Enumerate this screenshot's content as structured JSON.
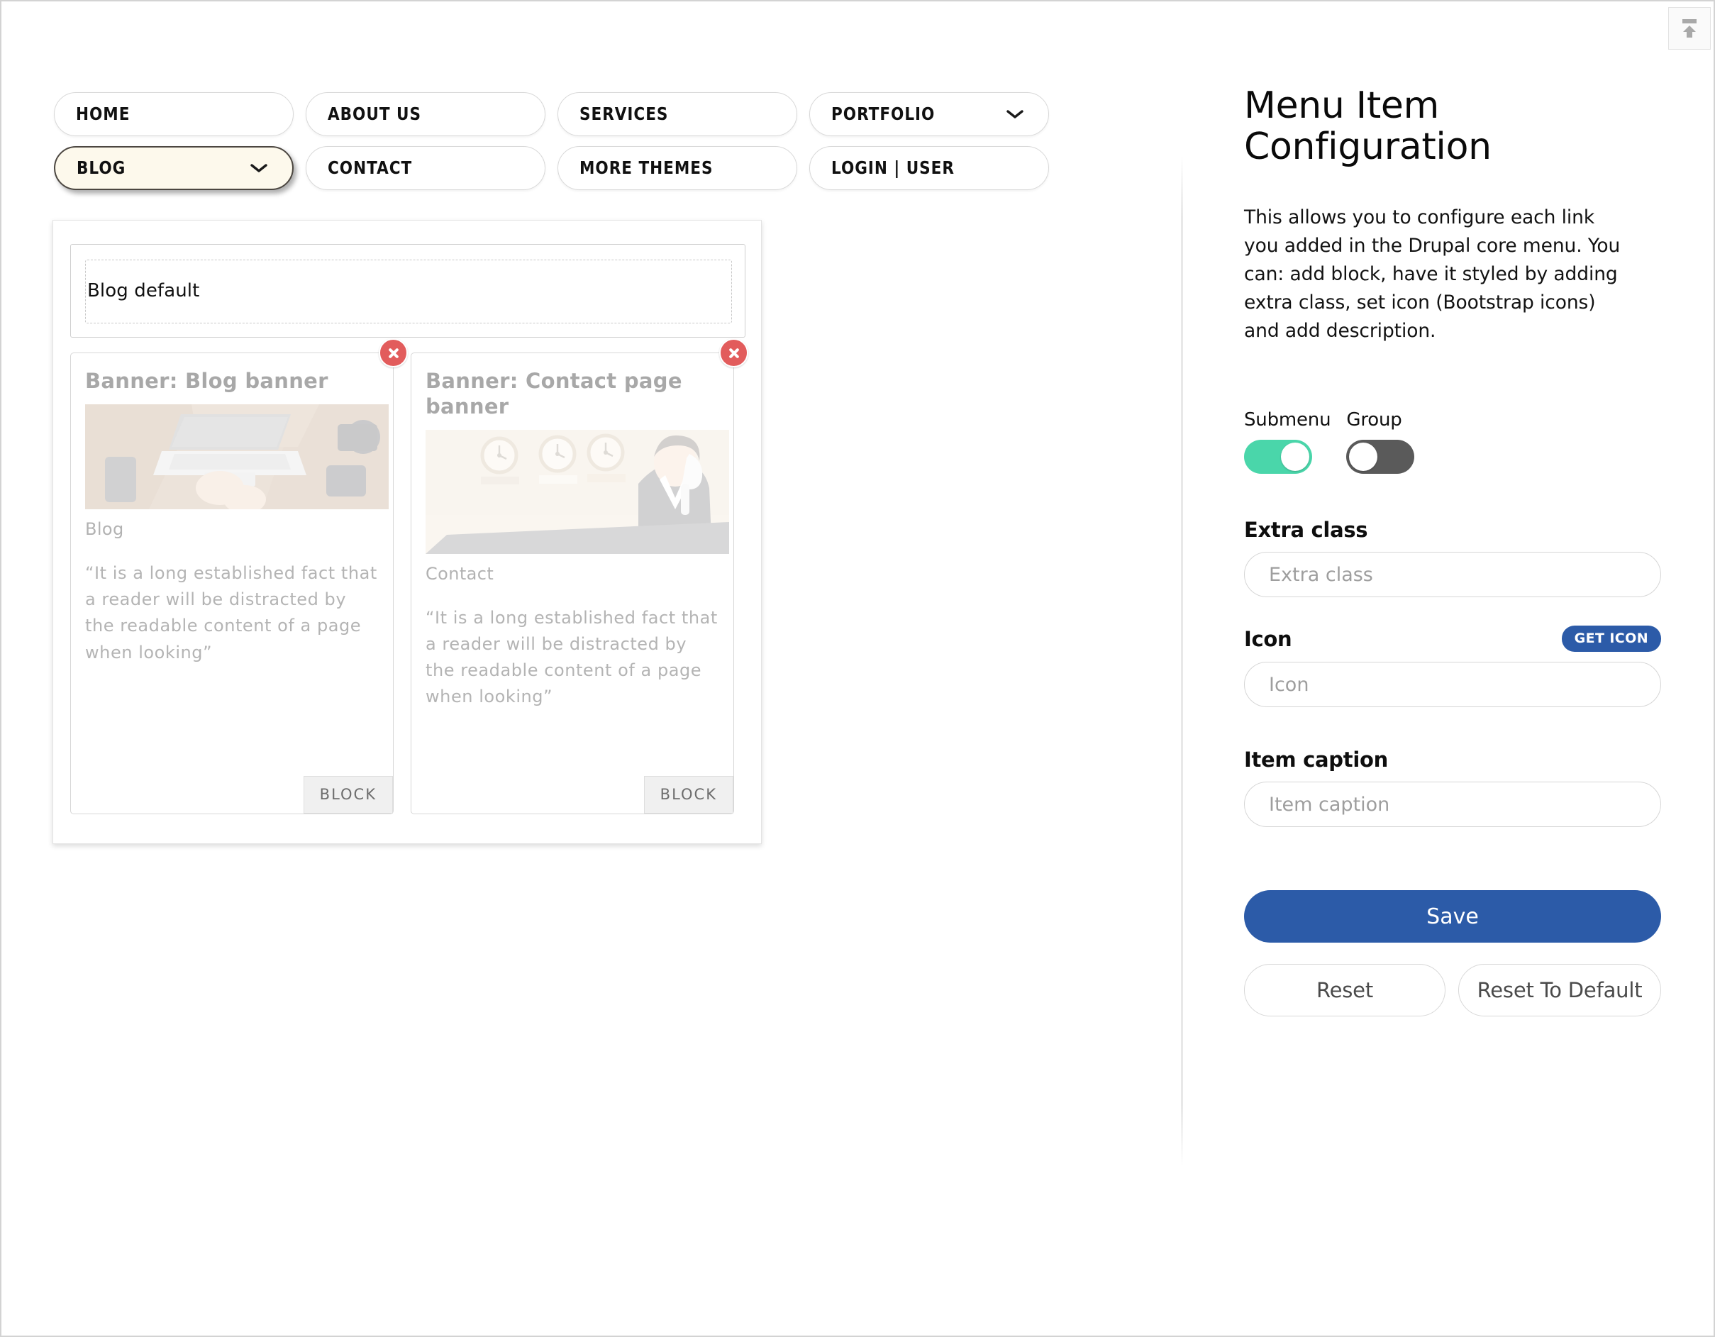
{
  "toolbar": {
    "to_top_icon": "upload-to-top-icon"
  },
  "nav": {
    "rows": [
      [
        {
          "label": "HOME",
          "active": false,
          "has_chevron": false
        },
        {
          "label": "ABOUT US",
          "active": false,
          "has_chevron": false
        },
        {
          "label": "SERVICES",
          "active": false,
          "has_chevron": false
        },
        {
          "label": "PORTFOLIO",
          "active": false,
          "has_chevron": true
        }
      ],
      [
        {
          "label": "BLOG",
          "active": true,
          "has_chevron": true
        },
        {
          "label": "CONTACT",
          "active": false,
          "has_chevron": false
        },
        {
          "label": "MORE THEMES",
          "active": false,
          "has_chevron": false
        },
        {
          "label": "LOGIN | USER",
          "active": false,
          "has_chevron": false
        }
      ]
    ]
  },
  "preview": {
    "section_title": "Blog default",
    "cards": [
      {
        "title": "Banner: Blog banner",
        "subtitle": "Blog",
        "body": "“It is a long established fact that a reader will be distracted by the readable content of a page when looking”",
        "tag": "BLOCK",
        "remove_icon": "close-icon"
      },
      {
        "title": "Banner: Contact page banner",
        "subtitle": "Contact",
        "body": "“It is a long established fact that a reader will be distracted by the readable content of a page when looking”",
        "tag": "BLOCK",
        "remove_icon": "close-icon"
      }
    ]
  },
  "panel": {
    "title": "Menu Item Configuration",
    "description": "This allows you to configure each link you added in the Drupal core menu. You can: add block, have it styled by adding extra class, set icon (Bootstrap icons) and add description.",
    "toggles": [
      {
        "label": "Submenu",
        "state": "on",
        "color": "#4ad6aa"
      },
      {
        "label": "Group",
        "state": "off",
        "color": "#5a5a5a"
      }
    ],
    "fields": [
      {
        "label": "Extra class",
        "value": "",
        "placeholder": "Extra class"
      },
      {
        "label": "Icon",
        "value": "",
        "placeholder": "Icon",
        "action_label": "GET ICON"
      },
      {
        "label": "Item caption",
        "value": "",
        "placeholder": "Item caption"
      }
    ],
    "buttons": {
      "save": "Save",
      "reset": "Reset",
      "reset_to_default": "Reset To Default"
    },
    "accent_color": "#2c5ba8"
  }
}
